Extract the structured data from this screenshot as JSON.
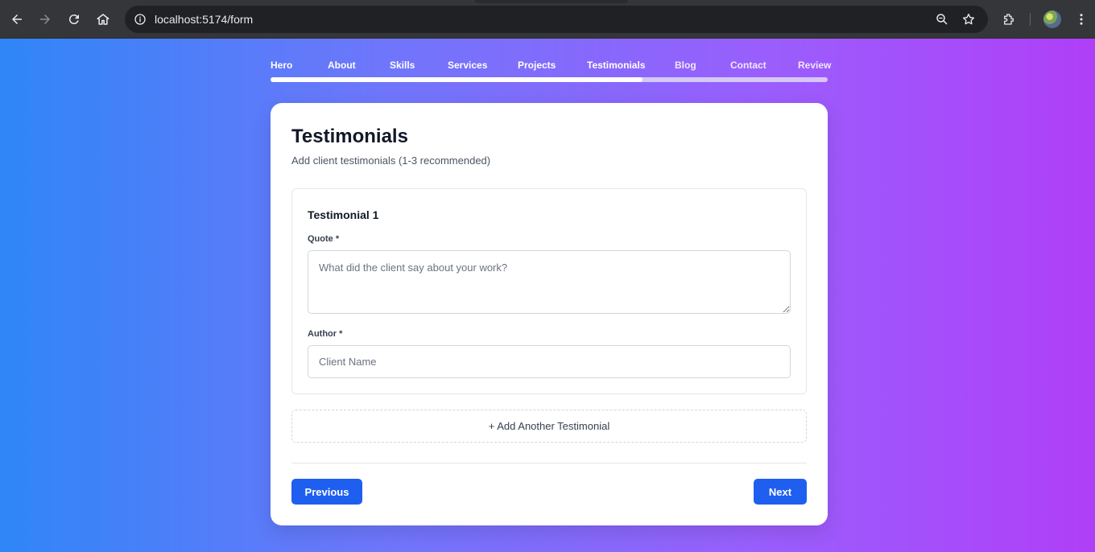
{
  "browser": {
    "url": "localhost:5174/form",
    "icons": [
      "back-icon",
      "forward-icon",
      "reload-icon",
      "home-icon",
      "site-info-icon",
      "zoom-icon",
      "bookmark-star-icon",
      "extensions-icon",
      "profile-avatar",
      "menu-kebab-icon"
    ]
  },
  "steps": [
    "Hero",
    "About",
    "Skills",
    "Services",
    "Projects",
    "Testimonials",
    "Blog",
    "Contact",
    "Review"
  ],
  "current_step_index": 5,
  "progress_fraction": 0.667,
  "colors": {
    "gradient_start": "#2f86f7",
    "gradient_end": "#b03ff8",
    "primary_button": "#1f5ff0"
  },
  "form": {
    "title": "Testimonials",
    "subtitle": "Add client testimonials (1-3 recommended)",
    "testimonial": {
      "title": "Testimonial 1",
      "quote_label": "Quote *",
      "quote_placeholder": "What did the client say about your work?",
      "quote_value": "",
      "author_label": "Author *",
      "author_placeholder": "Client Name",
      "author_value": ""
    },
    "add_label": "+ Add Another Testimonial",
    "prev_label": "Previous",
    "next_label": "Next"
  }
}
